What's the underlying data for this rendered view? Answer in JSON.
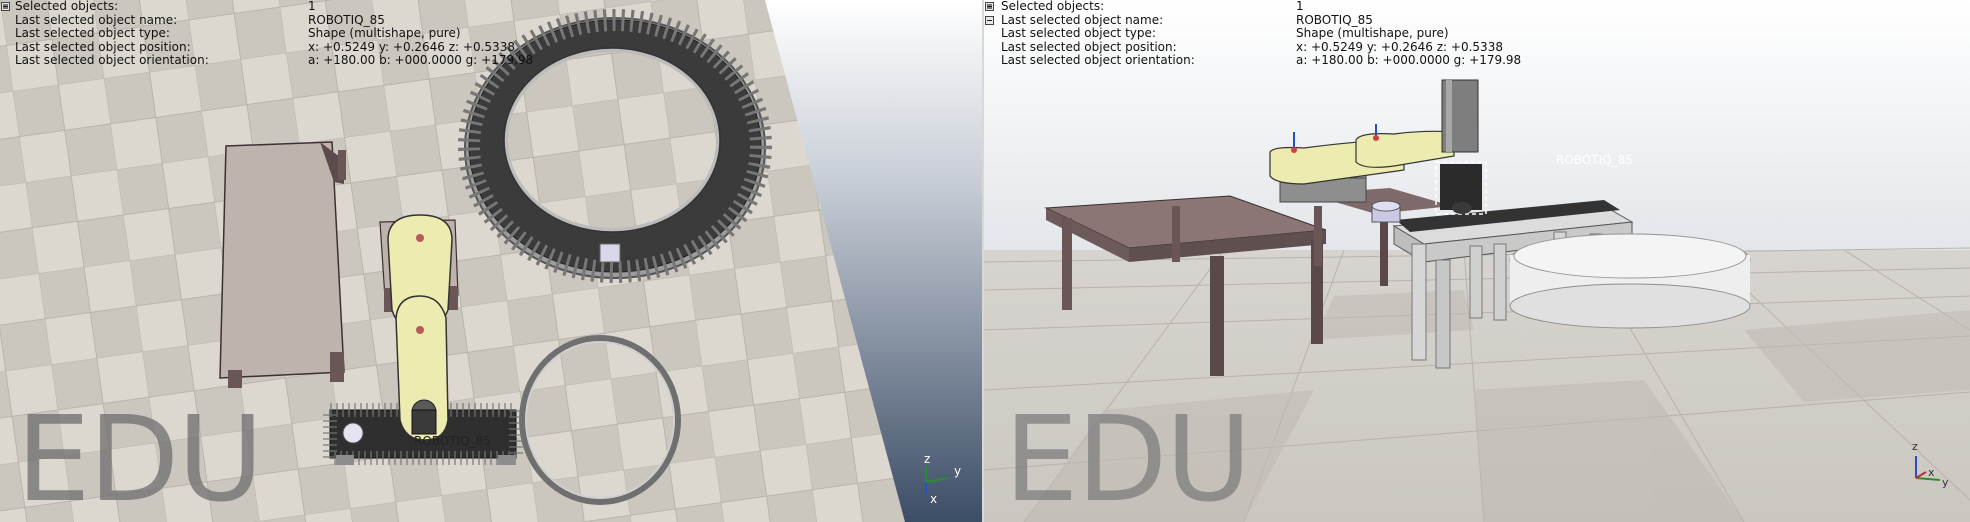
{
  "left_view": {
    "info": {
      "rows": [
        {
          "label": "Selected objects:",
          "value": "1"
        },
        {
          "label": "Last selected object name:",
          "value": "ROBOTIQ_85"
        },
        {
          "label": "Last selected object type:",
          "value": "Shape (multishape, pure)"
        },
        {
          "label": "Last selected object position:",
          "value": "x: +0.5249    y: +0.2646    z: +0.5338"
        },
        {
          "label": "Last selected object orientation:",
          "value": "a: +180.00    b: +000.0000    g: +179.98"
        }
      ]
    },
    "watermark": "EDU",
    "object_label": "ROBOTIQ_85",
    "axes": {
      "z": "z",
      "y": "y",
      "x": "x"
    }
  },
  "right_view": {
    "info": {
      "rows": [
        {
          "label": "Selected objects:",
          "value": "1"
        },
        {
          "label": "Last selected object name:",
          "value": "ROBOTIQ_85"
        },
        {
          "label": "Last selected object type:",
          "value": "Shape (multishape, pure)"
        },
        {
          "label": "Last selected object position:",
          "value": "x: +0.5249    y: +0.2646    z: +0.5338"
        },
        {
          "label": "Last selected object orientation:",
          "value": "a: +180.00    b: +000.0000    g: +179.98"
        }
      ]
    },
    "watermark": "EDU",
    "object_label": "ROBOTIQ_85",
    "axes": {
      "z": "z",
      "y": "y",
      "x": "x"
    }
  },
  "colors": {
    "floor_light": "#d9d5cd",
    "floor_dark": "#c4bfb7",
    "sky_top": "#5b6d86",
    "table_brown": "#7b6566",
    "robot_arm": "#ece7a8",
    "conveyor": "#3a3a3a"
  }
}
